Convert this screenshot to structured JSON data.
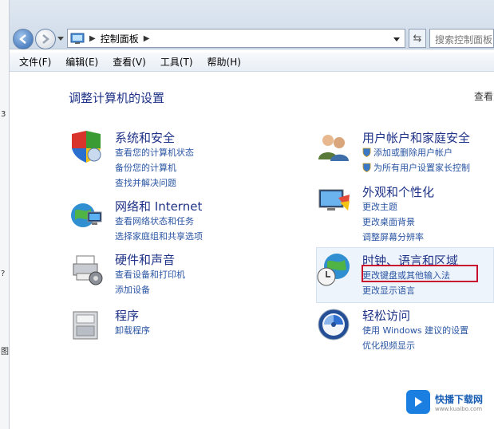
{
  "edge": {
    "c1": "3",
    "c2": "?",
    "c3": "图"
  },
  "address": {
    "crumb": "控制面板",
    "search_placeholder": "搜索控制面板"
  },
  "menu": [
    "文件(F)",
    "编辑(E)",
    "查看(V)",
    "工具(T)",
    "帮助(H)"
  ],
  "main": {
    "heading": "调整计算机的设置",
    "view_by": "查看方式"
  },
  "categories": {
    "system": {
      "title": "系统和安全",
      "links": [
        "查看您的计算机状态",
        "备份您的计算机",
        "查找并解决问题"
      ]
    },
    "network": {
      "title": "网络和 Internet",
      "links": [
        "查看网络状态和任务",
        "选择家庭组和共享选项"
      ]
    },
    "hardware": {
      "title": "硬件和声音",
      "links": [
        "查看设备和打印机",
        "添加设备"
      ]
    },
    "programs": {
      "title": "程序",
      "links": [
        "卸载程序"
      ]
    },
    "users": {
      "title": "用户帐户和家庭安全",
      "links": [
        "添加或删除用户帐户",
        "为所有用户设置家长控制"
      ]
    },
    "appearance": {
      "title": "外观和个性化",
      "links": [
        "更改主题",
        "更改桌面背景",
        "调整屏幕分辨率"
      ]
    },
    "clock": {
      "title": "时钟、语言和区域",
      "links": [
        "更改键盘或其他输入法",
        "更改显示语言"
      ]
    },
    "ease": {
      "title": "轻松访问",
      "links": [
        "使用 Windows 建议的设置",
        "优化视频显示"
      ]
    }
  },
  "watermark": {
    "title": "快播下载网",
    "subtitle": "www.kuaibo.com"
  },
  "colors": {
    "link": "#2a55a3",
    "title": "#1e3287",
    "highlight": "#c8102e"
  }
}
